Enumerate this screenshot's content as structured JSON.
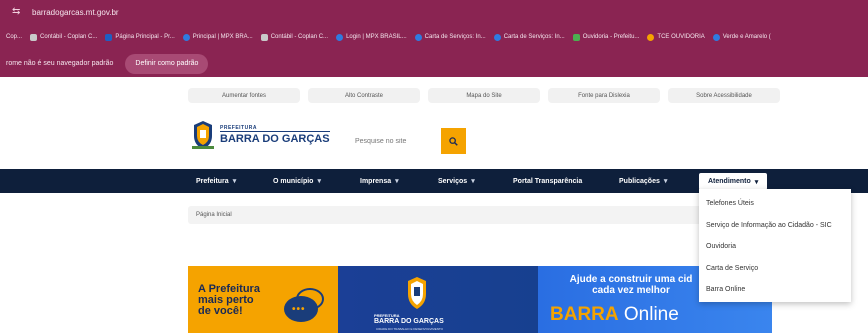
{
  "browser": {
    "url": "barradogarcas.mt.gov.br",
    "bookmarks": [
      {
        "label": "Cop...",
        "color": "#c9c9c9"
      },
      {
        "label": "Contábil - Coplan C...",
        "color": "#c9c9c9"
      },
      {
        "label": "Página Principal - Pr...",
        "color": "#1e5fc4"
      },
      {
        "label": "Principal | MPX BRA...",
        "color": "#2f7be0"
      },
      {
        "label": "Contábil - Coplan C...",
        "color": "#c9c9c9"
      },
      {
        "label": "Login | MPX BRASIL...",
        "color": "#2f7be0"
      },
      {
        "label": "Carta de Serviços: In...",
        "color": "#2f7be0"
      },
      {
        "label": "Carta de Serviços: In...",
        "color": "#2f7be0"
      },
      {
        "label": "Ouvidoria - Prefeitu...",
        "color": "#4caf50"
      },
      {
        "label": "TCE OUVIDORIA",
        "color": "#f5a300"
      },
      {
        "label": "Verde e Amarelo (",
        "color": "#2f7be0"
      }
    ],
    "infobar": {
      "message": "rome não é seu navegador padrão",
      "button": "Definir como padrão"
    }
  },
  "accessibility": [
    "Aumentar fontes",
    "Alto Contraste",
    "Mapa do Site",
    "Fonte para Dislexia",
    "Sobre Acessibilidade"
  ],
  "header": {
    "logo_top": "PREFEITURA",
    "logo_name": "BARRA DO GARÇAS",
    "search_placeholder": "Pesquise no site"
  },
  "nav": [
    "Prefeitura",
    "O município",
    "Imprensa",
    "Serviços",
    "Portal Transparência",
    "Publicações",
    "Atendimento"
  ],
  "breadcrumb": "Página Inicial",
  "dropdown": [
    "Telefones Úteis",
    "Serviço de Informação ao Cidadão - SIC",
    "Ouvidoria",
    "Carta de Serviço",
    "Barra Online"
  ],
  "banner": {
    "left_text": [
      "A Prefeitura",
      "mais perto",
      "de você!"
    ],
    "mid_pref": "PREFEITURA",
    "mid_logo": "BARRA DO GARÇAS",
    "mid_tag": "CIDADE DO TRABALHO E DESENVOLVIMENTO",
    "right_text": [
      "Ajude a construir uma cid",
      "cada vez melhor"
    ],
    "online_bold": "BARRA",
    "online_light": "Online"
  },
  "colors": {
    "chrome": "#8a2452",
    "nav": "#0e1f3b",
    "accent": "#f5a300",
    "brand_blue": "#1a3d7a"
  }
}
